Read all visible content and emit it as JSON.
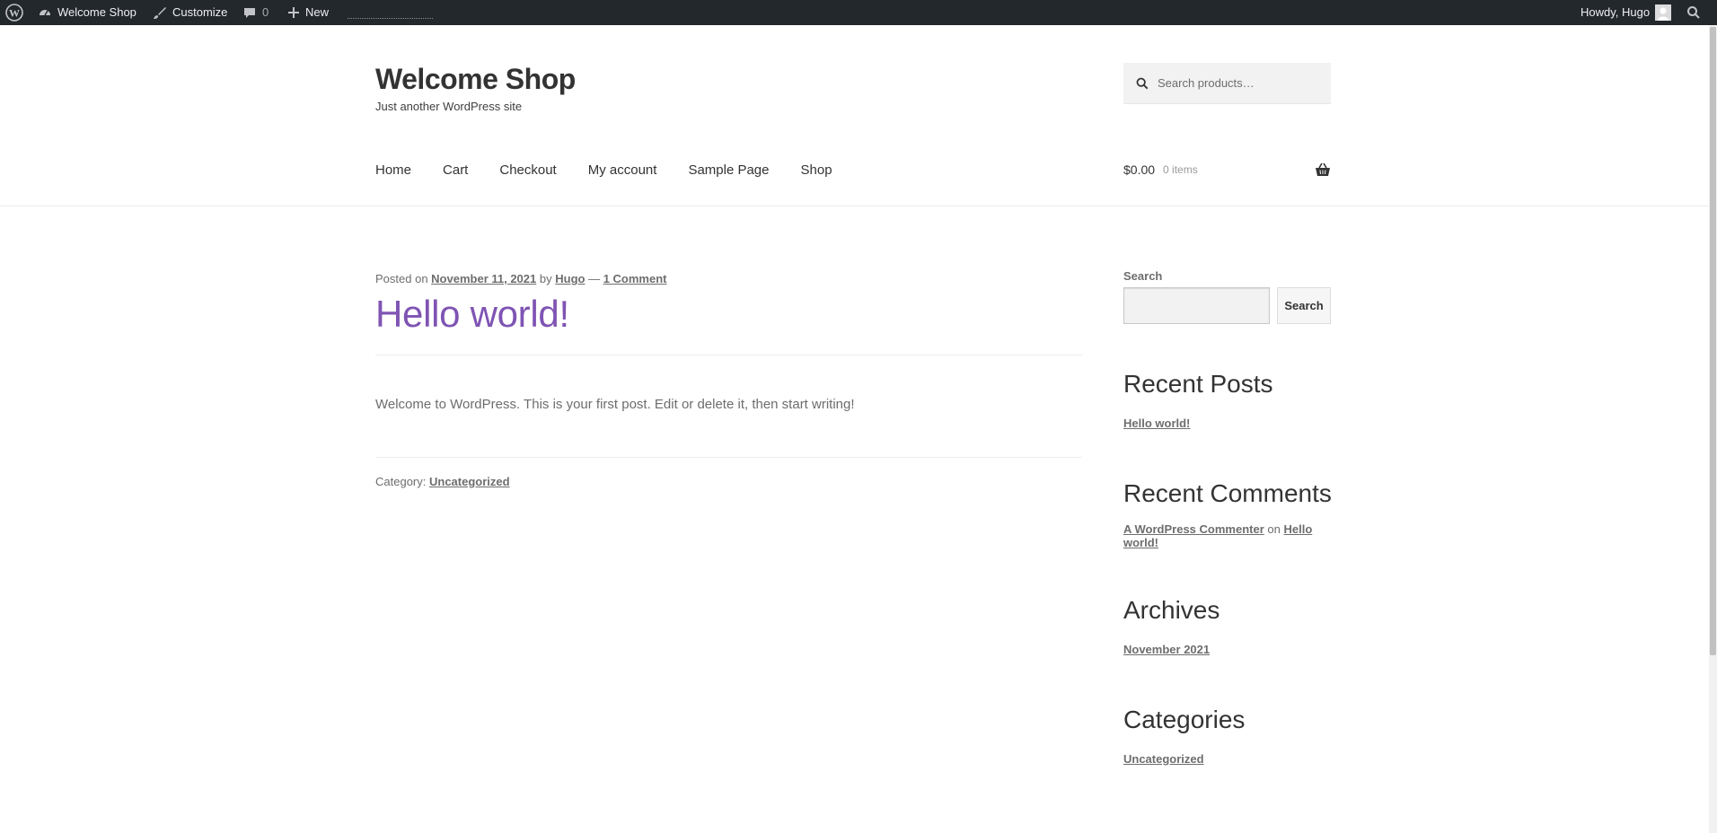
{
  "admin_bar": {
    "site_name": "Welcome Shop",
    "customize": "Customize",
    "comments_count": "0",
    "new": "New",
    "howdy": "Howdy, Hugo"
  },
  "header": {
    "site_title": "Welcome Shop",
    "tagline": "Just another WordPress site",
    "search_placeholder": "Search products…",
    "nav": [
      "Home",
      "Cart",
      "Checkout",
      "My account",
      "Sample Page",
      "Shop"
    ],
    "cart_total": "$0.00",
    "cart_items": "0 items"
  },
  "post": {
    "posted_on": "Posted on",
    "date": "November 11, 2021",
    "by": "by",
    "author": "Hugo",
    "dash": "—",
    "comments": "1 Comment",
    "title": "Hello world!",
    "body": "Welcome to WordPress. This is your first post. Edit or delete it, then start writing!",
    "category_label": "Category:",
    "category": "Uncategorized"
  },
  "sidebar": {
    "search_label": "Search",
    "search_button": "Search",
    "recent_posts_title": "Recent Posts",
    "recent_post": "Hello world!",
    "recent_comments_title": "Recent Comments",
    "commenter": "A WordPress Commenter",
    "on": "on",
    "comment_post_line1": "Hello",
    "comment_post_line2": "world!",
    "archives_title": "Archives",
    "archive": "November 2021",
    "categories_title": "Categories",
    "category": "Uncategorized"
  },
  "colors": {
    "admin_bar": "#23282d",
    "accent": "#7f54b3",
    "text": "#6d6d6d",
    "heading": "#333333"
  }
}
